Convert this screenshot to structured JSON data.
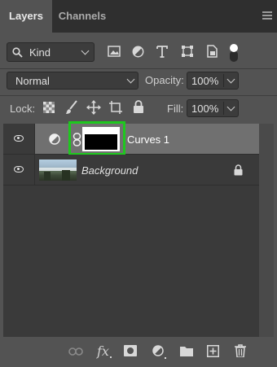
{
  "tabs": [
    {
      "label": "Layers",
      "active": true
    },
    {
      "label": "Channels",
      "active": false
    }
  ],
  "filter": {
    "kind_label": "Kind"
  },
  "blend": {
    "mode": "Normal",
    "opacity_label": "Opacity:",
    "opacity_value": "100%"
  },
  "lock": {
    "label": "Lock:",
    "fill_label": "Fill:",
    "fill_value": "100%"
  },
  "layers": [
    {
      "name": "Curves 1",
      "type": "adjustment",
      "selected": true,
      "visible": true
    },
    {
      "name": "Background",
      "type": "image",
      "locked": true,
      "visible": true
    }
  ],
  "colors": {
    "panel": "#535353",
    "tabbar": "#2f2f2f",
    "selected_row": "#707070",
    "highlight": "#1ec81e",
    "list_bg": "#3a3a3a"
  },
  "bottom_icons": [
    "link-icon",
    "fx-icon",
    "mask-icon",
    "adjustment-icon",
    "folder-icon",
    "new-layer-icon",
    "trash-icon"
  ]
}
